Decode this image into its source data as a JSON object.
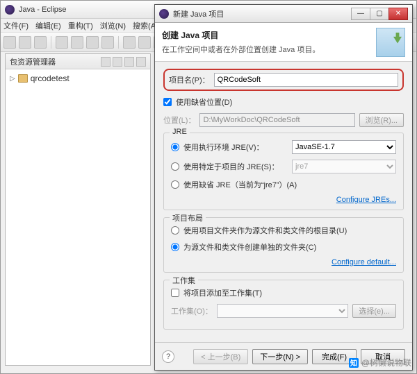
{
  "eclipse": {
    "title": "Java - Eclipse",
    "menu": [
      "文件(F)",
      "编辑(E)",
      "重构(T)",
      "浏览(N)",
      "搜索(A"
    ]
  },
  "explorer": {
    "title": "包资源管理器",
    "project": "qrcodetest"
  },
  "dialog": {
    "title": "新建 Java 项目",
    "banner_title": "创建 Java 项目",
    "banner_desc": "在工作空间中或者在外部位置创建 Java 项目。",
    "project_name_label": "项目名(P)：",
    "project_name_value": "QRCodeSoft",
    "use_default_loc": "使用缺省位置(D)",
    "location_label": "位置(L)：",
    "location_value": "D:\\MyWorkDoc\\QRCodeSoft",
    "browse_btn": "浏览(R)...",
    "jre": {
      "group": "JRE",
      "exec_env": "使用执行环境 JRE(V)：",
      "exec_env_value": "JavaSE-1.7",
      "project_jre": "使用特定于项目的 JRE(S)：",
      "project_jre_value": "jre7",
      "default_jre": "使用缺省 JRE（当前为“jre7”）(A)",
      "config_link": "Configure JREs..."
    },
    "layout": {
      "group": "项目布局",
      "opt1": "使用项目文件夹作为源文件和类文件的根目录(U)",
      "opt2": "为源文件和类文件创建单独的文件夹(C)",
      "config_link": "Configure default..."
    },
    "ws": {
      "group": "工作集",
      "add": "将项目添加至工作集(T)",
      "label": "工作集(O)：",
      "select_btn": "选择(e)..."
    },
    "footer": {
      "back": "< 上一步(B)",
      "next": "下一步(N) >",
      "finish": "完成(F)",
      "cancel": "取消"
    }
  },
  "watermark": "@树懒说物联"
}
